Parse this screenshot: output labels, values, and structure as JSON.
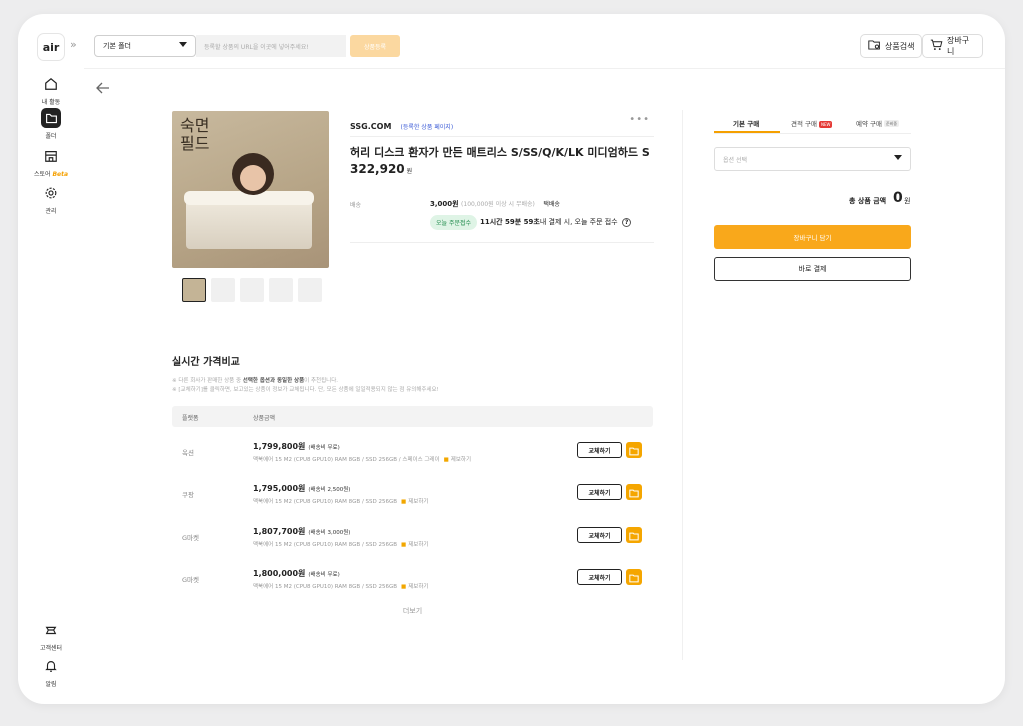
{
  "sidebar": {
    "logo": "air",
    "collapse_icon": "»",
    "items": [
      {
        "label": "내 활동",
        "icon": "home-icon"
      },
      {
        "label": "폴더",
        "icon": "folder-icon",
        "active": true
      },
      {
        "label": "스토어",
        "beta": "Beta",
        "icon": "store-icon"
      },
      {
        "label": "관리",
        "icon": "gear-icon"
      }
    ],
    "bottom": [
      {
        "label": "고객센터",
        "icon": "support-icon"
      },
      {
        "label": "알림",
        "icon": "bell-icon"
      }
    ]
  },
  "topbar": {
    "folder_select": "기본 폴더",
    "url_placeholder": "등록할 상품의 URL을 이곳에 넣어주세요!",
    "register_label": "상품등록",
    "search_label": "상품검색",
    "cart_label": "장바구니"
  },
  "product": {
    "image_text": "숙면\n필드",
    "seller": "SSG.COM",
    "seller_link": "(등록한 상품 페이지)",
    "title": "허리 디스크 환자가 만든 매트리스 S/SS/Q/K/LK 미디엄하드 S",
    "price": "322,920",
    "price_unit": "원",
    "shipping_label": "배송",
    "shipping_fee": "3,000원",
    "shipping_condition": "(100,000원 이상 시 무배송)",
    "shipping_type": "택배송",
    "today_badge": "오늘 주문접수",
    "today_bold": "11시간 59분 59초",
    "today_rest": "내 결제 시, 오늘 주문 접수"
  },
  "compare": {
    "title": "실시간 가격비교",
    "note1": "※ 다른 회사가 판매한 상품 중",
    "note1_bold": "선택한 옵션과 동일한 상품",
    "note1_end": "이 추천됩니다.",
    "note2": "※ [교체하기]를 클릭하면, 보고있는 상품이 정보가 교체됩니다. 단, 모든 상품에 일일적용되지 않는 점 유의해주세요!",
    "col_platform": "플랫폼",
    "col_price": "상품금액",
    "rows": [
      {
        "platform": "옥션",
        "price": "1,799,800원",
        "fee": "(배송비 무료)",
        "spec": "맥북에어 15 M2 (CPU8 GPU10) RAM 8GB / SSD 256GB / 스페이스 그레이",
        "save": "제보하기",
        "replace": "교체하기"
      },
      {
        "platform": "쿠팡",
        "price": "1,795,000원",
        "fee": "(배송비 2,500원)",
        "spec": "맥북에어 15 M2 (CPU8 GPU10) RAM 8GB / SSD 256GB",
        "save": "제보하기",
        "replace": "교체하기"
      },
      {
        "platform": "G마켓",
        "price": "1,807,700원",
        "fee": "(배송비 3,000원)",
        "spec": "맥북에어 15 M2 (CPU8 GPU10) RAM 8GB / SSD 256GB",
        "save": "제보하기",
        "replace": "교체하기"
      },
      {
        "platform": "G마켓",
        "price": "1,800,000원",
        "fee": "(배송비 무료)",
        "spec": "맥북에어 15 M2 (CPU8 GPU10) RAM 8GB / SSD 256GB",
        "save": "제보하기",
        "replace": "교체하기"
      }
    ],
    "more": "더보기"
  },
  "purchase": {
    "tab_basic": "기본 구매",
    "tab_quote": "견적 구매",
    "tab_quote_badge": "NEW",
    "tab_reserve": "예약 구매",
    "tab_reserve_badge": "준비중",
    "option_placeholder": "옵션 선택",
    "total_label": "총 상품 금액",
    "total_value": "0",
    "total_unit": "원",
    "cart_button": "장바구니 담기",
    "buy_button": "바로 결제"
  }
}
